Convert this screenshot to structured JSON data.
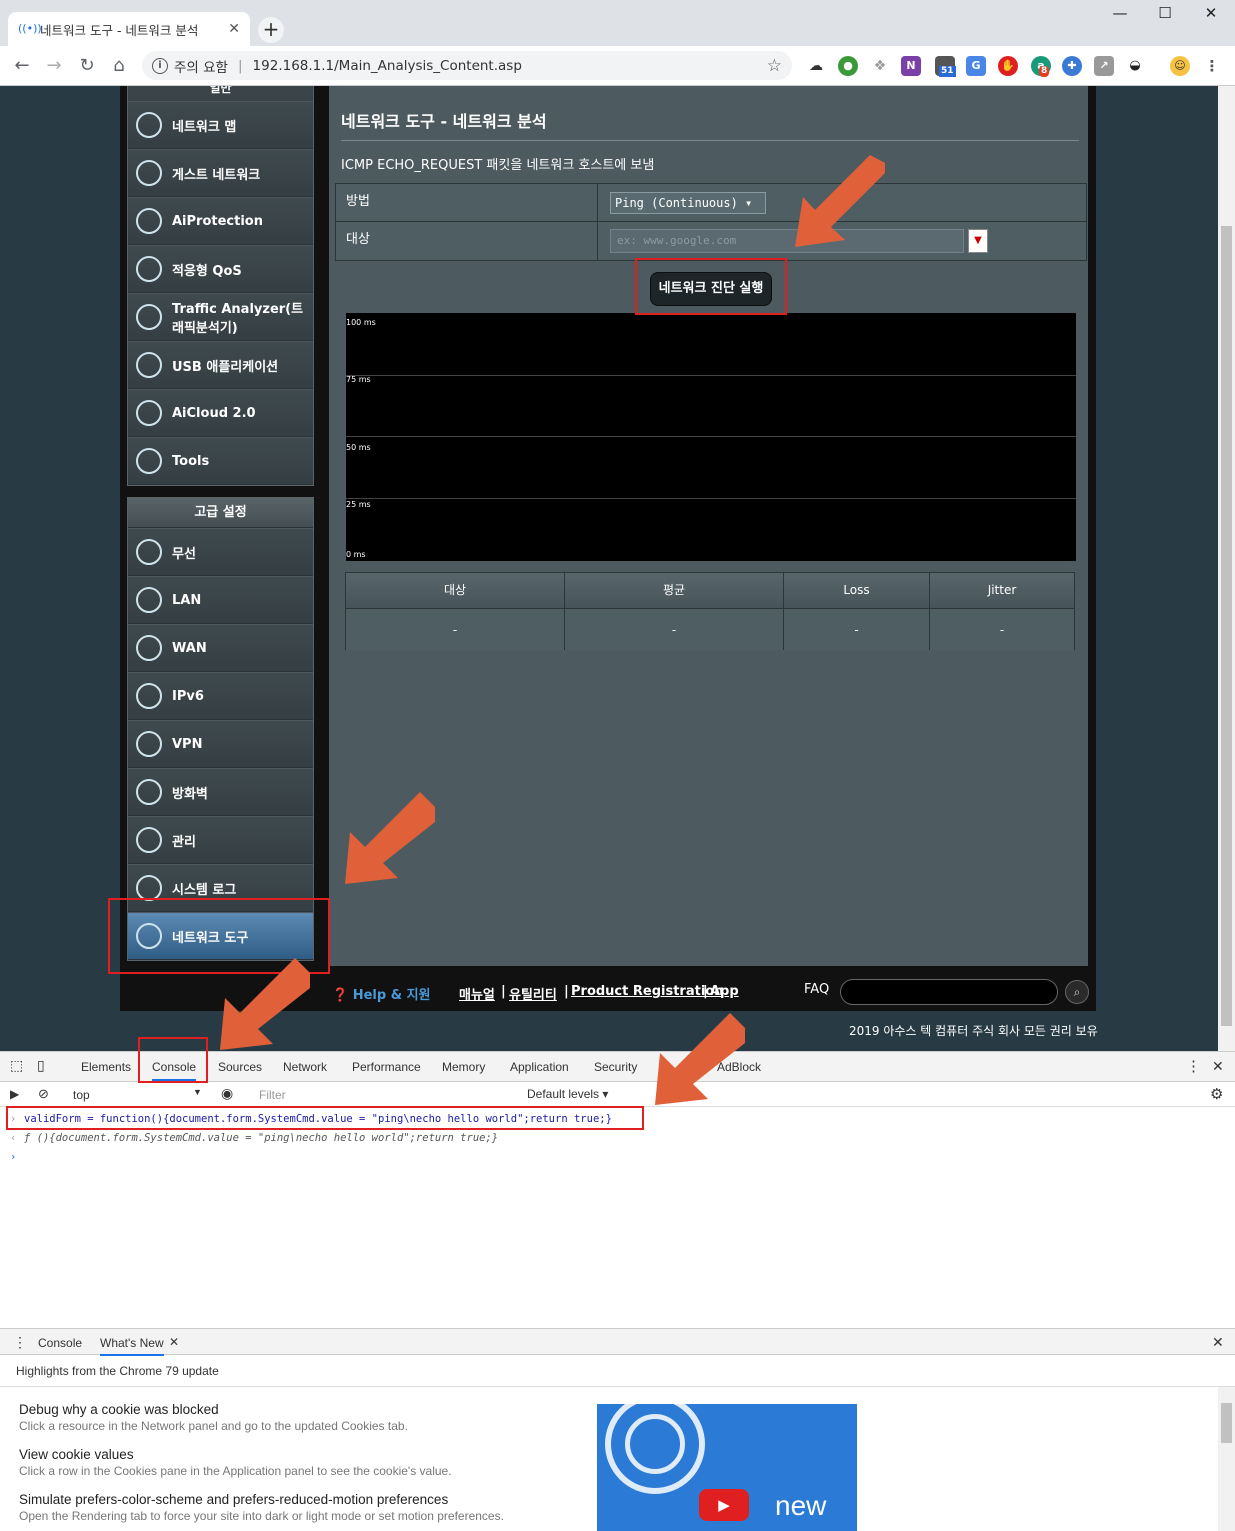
{
  "browser": {
    "tab_title": "네트워크 도구 - 네트워크 분석",
    "new_tab": "+",
    "minimize": "—",
    "maximize": "☐",
    "close": "✕",
    "security_label": "주의 요함",
    "url": "192.168.1.1/Main_Analysis_Content.asp",
    "badge1": "51",
    "badge2": "8"
  },
  "sidebar": {
    "general_header": "일반",
    "general_items": [
      {
        "label": "네트워크 맵",
        "icon": "globe-icon"
      },
      {
        "label": "게스트 네트워크",
        "icon": "guest-network-icon"
      },
      {
        "label": "AiProtection",
        "icon": "shield-lock-icon"
      },
      {
        "label": "적응형 QoS",
        "icon": "speedometer-icon"
      },
      {
        "label": "Traffic Analyzer(트래픽분석기)",
        "icon": "traffic-icon"
      },
      {
        "label": "USB 애플리케이션",
        "icon": "usb-icon"
      },
      {
        "label": "AiCloud 2.0",
        "icon": "cloud-icon"
      },
      {
        "label": "Tools",
        "icon": "wrench-icon"
      }
    ],
    "advanced_header": "고급 설정",
    "advanced_items": [
      {
        "label": "무선",
        "icon": "wifi-icon"
      },
      {
        "label": "LAN",
        "icon": "lan-icon"
      },
      {
        "label": "WAN",
        "icon": "wan-globe-icon"
      },
      {
        "label": "IPv6",
        "icon": "ipv6-icon"
      },
      {
        "label": "VPN",
        "icon": "vpn-icon"
      },
      {
        "label": "방화벽",
        "icon": "firewall-icon"
      },
      {
        "label": "관리",
        "icon": "admin-gear-icon"
      },
      {
        "label": "시스템 로그",
        "icon": "system-log-icon"
      },
      {
        "label": "네트워크 도구",
        "icon": "network-tools-icon"
      }
    ]
  },
  "content": {
    "title": "네트워크 도구 - 네트워크 분석",
    "description": "ICMP ECHO_REQUEST 패킷을 네트워크 호스트에 보냄",
    "method_label": "방법",
    "method_value": "Ping (Continuous) ▾",
    "target_label": "대상",
    "target_placeholder": "ex: www.google.com",
    "run_button": "네트워크 진단 실행",
    "chart_labels": [
      "100 ms",
      "75 ms",
      "50 ms",
      "25 ms",
      "0 ms"
    ],
    "result_headers": [
      "대상",
      "평균",
      "Loss",
      "Jitter"
    ],
    "result_values": [
      "-",
      "-",
      "-",
      "-"
    ]
  },
  "footer": {
    "help": "Help & 지원",
    "manual": "매뉴얼",
    "sep": "|",
    "utility": "유틸리티",
    "product_registration": "Product Registration",
    "app": "App",
    "faq": "FAQ",
    "copyright": "2019 아수스 텍 컴퓨터 주식 회사 모든 권리 보유"
  },
  "devtools": {
    "tabs": [
      "Elements",
      "Console",
      "Sources",
      "Network",
      "Performance",
      "Memory",
      "Application",
      "Security",
      "AdBlock"
    ],
    "context": "top",
    "filter_placeholder": "Filter",
    "levels": "Default levels ▾",
    "input_line": "validForm = function(){document.form.SystemCmd.value = \"ping\\necho hello world\";return true;}",
    "output_line": "ƒ (){document.form.SystemCmd.value = \"ping\\necho hello world\";return true;}",
    "drawer_tabs": [
      "Console",
      "What's New"
    ],
    "whats_new_header": "Highlights from the Chrome 79 update",
    "items": [
      {
        "title": "Debug why a cookie was blocked",
        "desc": "Click a resource in the Network panel and go to the updated Cookies tab."
      },
      {
        "title": "View cookie values",
        "desc": "Click a row in the Cookies pane in the Application panel to see the cookie's value."
      },
      {
        "title": "Simulate prefers-color-scheme and prefers-reduced-motion preferences",
        "desc": "Open the Rendering tab to force your site into dark or light mode or set motion preferences."
      }
    ],
    "promo_text": "new"
  }
}
